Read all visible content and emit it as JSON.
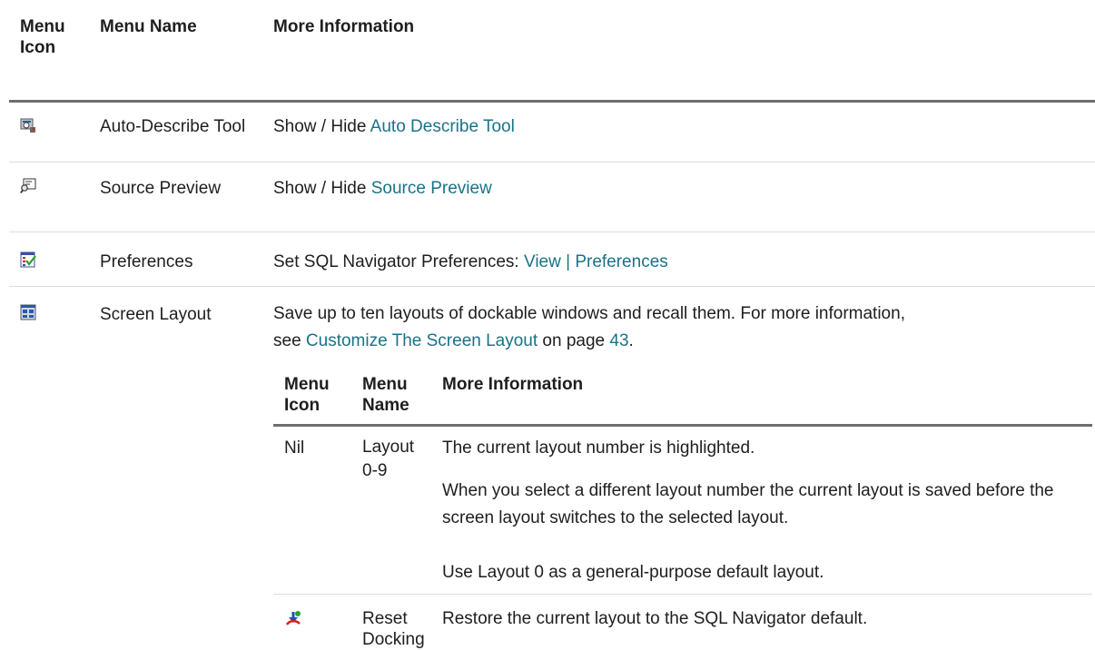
{
  "outer_table": {
    "headers": {
      "icon": "Menu Icon",
      "name": "Menu Name",
      "info": "More Information"
    },
    "rows": [
      {
        "icon": "auto-describe-icon",
        "name": "Auto-Describe Tool",
        "info_prefix": "Show / Hide ",
        "info_link": "Auto Describe Tool"
      },
      {
        "icon": "source-preview-icon",
        "name": "Source Preview",
        "info_prefix": "Show / Hide ",
        "info_link": "Source Preview"
      },
      {
        "icon": "preferences-icon",
        "name": "Preferences",
        "info_prefix": "Set SQL Navigator Preferences: ",
        "info_link": "View | Preferences"
      },
      {
        "icon": "screen-layout-icon",
        "name": "Screen Layout",
        "info_line1": "Save up to ten layouts of dockable windows and recall them. For more information,",
        "info_see": "see ",
        "info_link": "Customize The Screen Layout",
        "info_on_page": " on page ",
        "info_page": "43",
        "info_period": "."
      }
    ]
  },
  "inner_table": {
    "headers": {
      "icon": "Menu Icon",
      "name": "Menu Name",
      "info": "More Information"
    },
    "rows": [
      {
        "icon_text": "Nil",
        "name": "Layout 0-9",
        "info": [
          "The current layout number is highlighted.",
          "When you select a different layout number the current layout is saved before the screen layout switches to the selected layout.",
          "Use Layout 0 as a general-purpose default layout."
        ]
      },
      {
        "icon": "reset-docking-icon",
        "name": "Reset Docking",
        "info": [
          "Restore the current layout to the SQL Navigator default."
        ]
      }
    ]
  }
}
